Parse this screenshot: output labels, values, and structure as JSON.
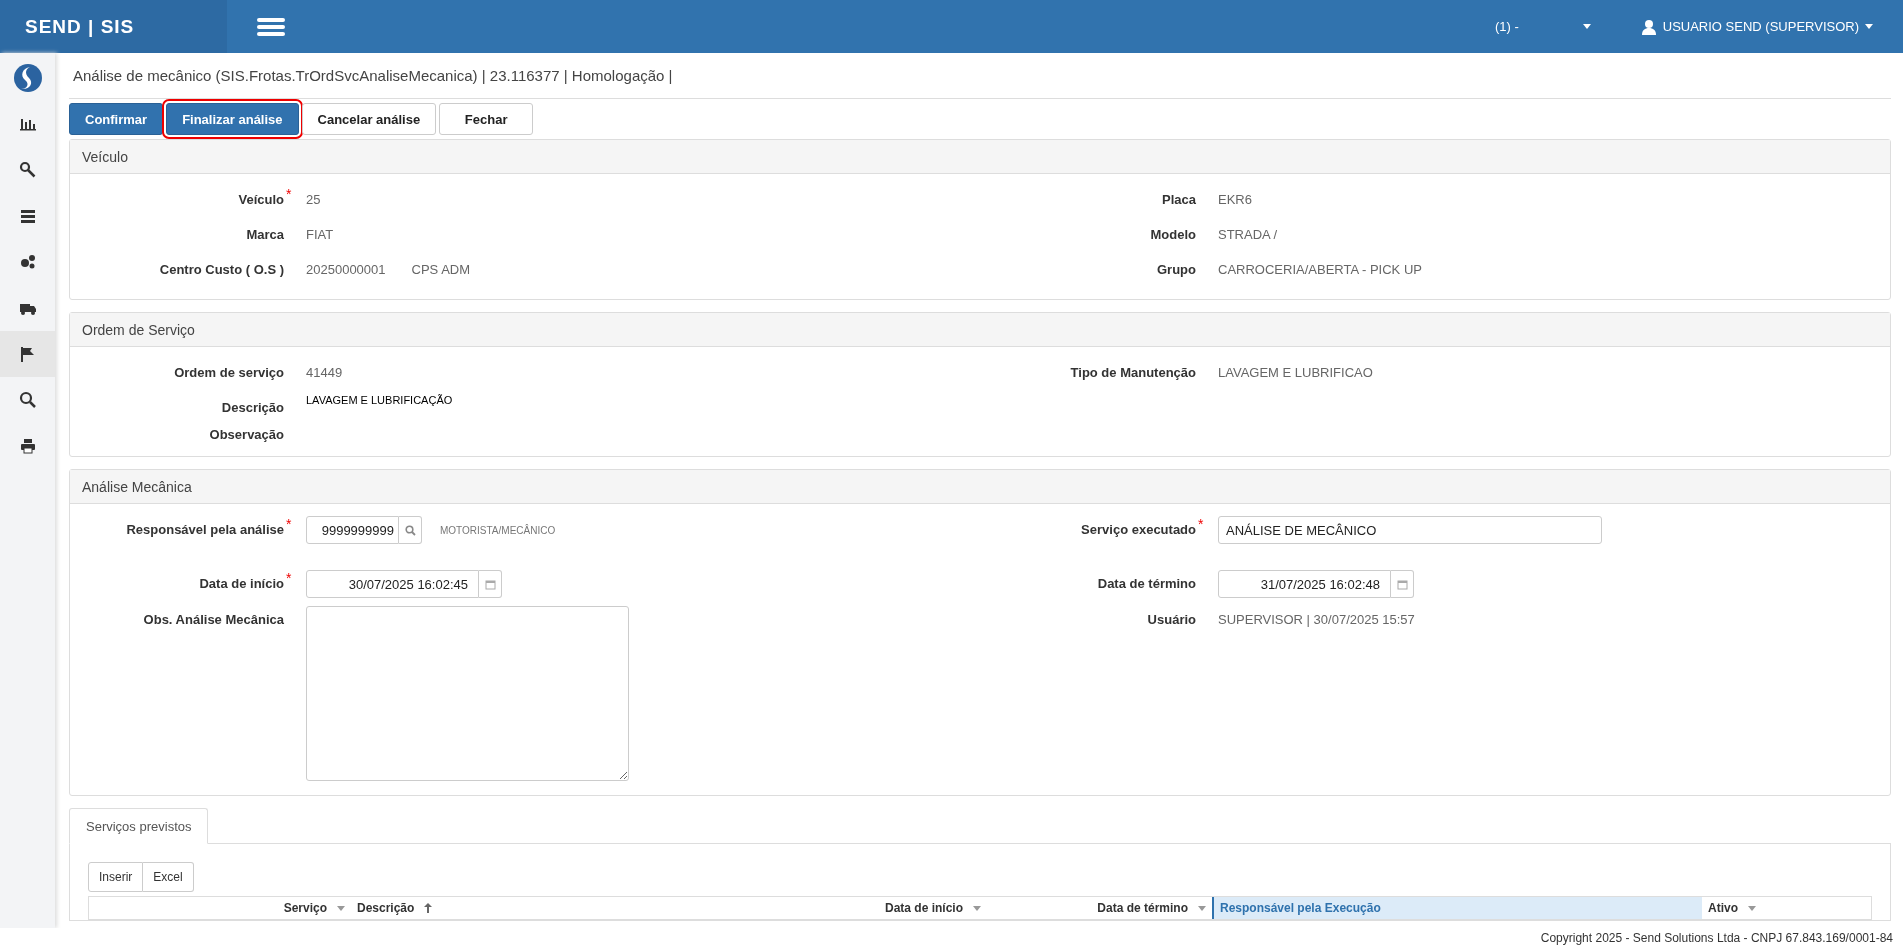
{
  "topbar": {
    "brand": "SEND | SIS",
    "company": "(1) -",
    "user": "USUARIO SEND (SUPERVISOR)"
  },
  "sidebar": {
    "items": [
      {
        "selected": false
      },
      {
        "selected": false
      },
      {
        "selected": false
      },
      {
        "selected": false
      },
      {
        "selected": false
      },
      {
        "selected": true
      },
      {
        "selected": false
      },
      {
        "selected": false
      }
    ]
  },
  "page_title": "Análise de mecânico (SIS.Frotas.TrOrdSvcAnaliseMecanica) | 23.116377 | Homologação |",
  "toolbar": [
    {
      "label": "Confirmar",
      "kind": "primary",
      "outlined": false
    },
    {
      "label": "Finalizar análise",
      "kind": "primary",
      "outlined": true
    },
    {
      "label": "Cancelar análise",
      "kind": "default",
      "outlined": false
    },
    {
      "label": "Fechar",
      "kind": "default",
      "outlined": false
    }
  ],
  "panels": [
    {
      "title": "Veículo",
      "left": [
        {
          "label": "Veículo",
          "required_mark": "*",
          "kind": "text",
          "value": "25"
        },
        {
          "label": "Marca",
          "kind": "text",
          "value": "FIAT"
        },
        {
          "label": "Centro Custo ( O.S )",
          "kind": "text",
          "value": "20250000001",
          "extra": "CPS ADM"
        }
      ],
      "right": [
        {
          "label": "Placa",
          "kind": "text",
          "value": "EKR6"
        },
        {
          "label": "Modelo",
          "kind": "text",
          "value": "STRADA /"
        },
        {
          "label": "Grupo",
          "kind": "text",
          "value": "CARROCERIA/ABERTA - PICK UP"
        }
      ]
    },
    {
      "title": "Ordem de Serviço",
      "left": [
        {
          "label": "Ordem de serviço",
          "kind": "text",
          "value": "41449"
        },
        {
          "label": "Descrição",
          "kind": "caption",
          "value": "LAVAGEM E LUBRIFICAÇÃO"
        },
        {
          "label": "Observação",
          "kind": "caption"
        }
      ],
      "right": [
        {
          "label": "Tipo de Manutenção",
          "kind": "text",
          "value": "LAVAGEM E LUBRIFICAO"
        }
      ]
    },
    {
      "title": "Análise Mecânica",
      "left": [
        {
          "label": "Responsável pela análise",
          "required_mark": "*",
          "kind": "lookup",
          "value": "9999999999",
          "note": "MOTORISTA/MECÂNICO"
        },
        {
          "label": "Data de início",
          "required_mark": "*",
          "kind": "datetime",
          "value": "30/07/2025 16:02:45"
        },
        {
          "label": "Obs. Análise Mecânica",
          "kind": "textarea"
        }
      ],
      "right": [
        {
          "label": "Serviço executado",
          "required_mark": "*",
          "kind": "input",
          "value": "ANÁLISE DE MECÂNICO"
        },
        {
          "label": "Data de término",
          "kind": "datetime",
          "value": "31/07/2025 16:02:48"
        },
        {
          "label": "Usuário",
          "kind": "text",
          "value": "SUPERVISOR | 30/07/2025 15:57"
        }
      ]
    }
  ],
  "tabs": [
    {
      "label": "Serviços previstos",
      "selected": true
    }
  ],
  "grid_toolbar": [
    "Inserir",
    "Excel"
  ],
  "table": {
    "columns": [
      {
        "label": "Serviço",
        "sorted": false,
        "selected": false
      },
      {
        "label": "Descrição",
        "sorted": true,
        "selected": false
      },
      {
        "label": "Data de início",
        "sorted": false,
        "selected": false
      },
      {
        "label": "Data de término",
        "sorted": false,
        "selected": false
      },
      {
        "label": "Responsável pela Execução",
        "sorted": false,
        "selected": true
      },
      {
        "label": "Ativo",
        "sorted": false,
        "selected": false
      }
    ]
  },
  "footer": "Copyright 2025 - Send Solutions Ltda - CNPJ 67.843.169/0001-84"
}
